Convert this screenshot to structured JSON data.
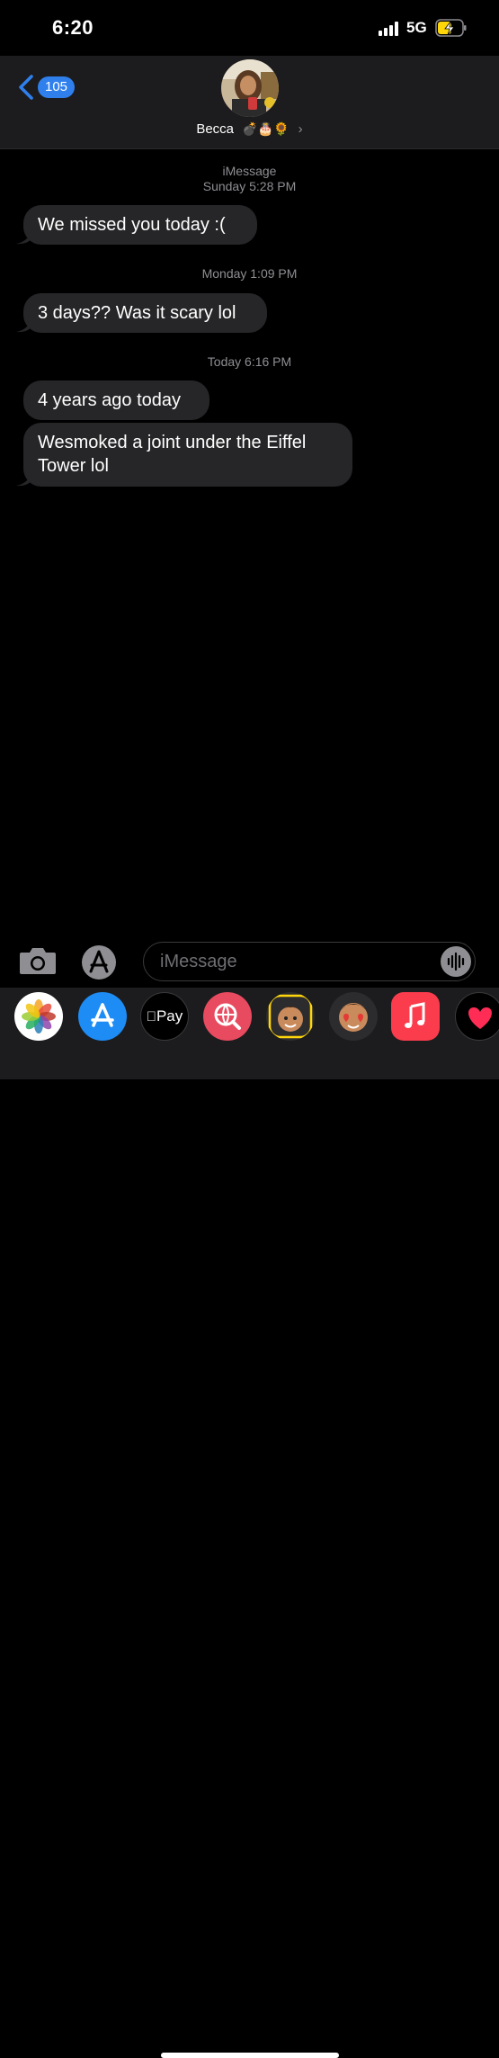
{
  "status": {
    "time": "6:20",
    "network": "5G"
  },
  "header": {
    "back_count": "105",
    "contact_name": "Becca",
    "contact_emojis": "💣🎂🌻",
    "chevron": "›"
  },
  "thread": {
    "service_label": "iMessage",
    "groups": [
      {
        "timestamp": "Sunday 5:28 PM",
        "messages": [
          "We missed you today :("
        ]
      },
      {
        "timestamp": "Monday 1:09 PM",
        "messages": [
          "3 days?? Was it scary lol"
        ]
      },
      {
        "timestamp": "Today 6:16 PM",
        "messages": [
          "4 years ago today",
          "Wesmoked a joint under the Eiffel Tower lol"
        ]
      }
    ]
  },
  "composer": {
    "placeholder": "iMessage",
    "value": ""
  },
  "app_drawer": {
    "items": [
      "photos-icon",
      "app-store-icon",
      "apple-pay-icon",
      "image-search-icon",
      "memoji-icon",
      "memoji-sticker-icon",
      "music-icon",
      "digital-touch-icon"
    ],
    "apple_pay_label": "Pay"
  },
  "colors": {
    "bubble_received": "#262628",
    "badge_blue": "#2f80ed",
    "background": "#000000"
  }
}
